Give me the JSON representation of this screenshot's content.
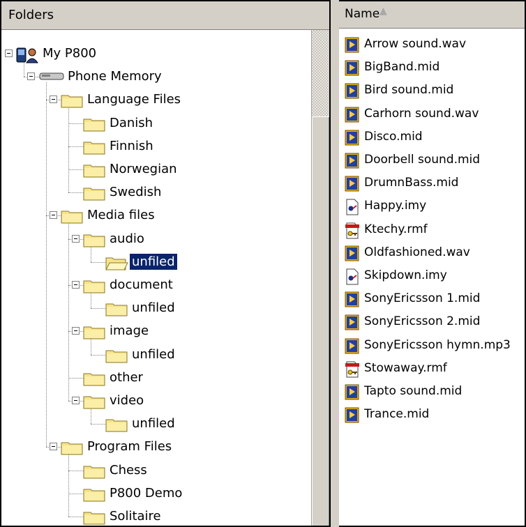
{
  "folders_pane": {
    "header": "Folders"
  },
  "files_pane": {
    "column_header": "Name",
    "sort_indicator": "▲"
  },
  "tree": [
    {
      "label": "My P800",
      "depth": 0,
      "kind": "device",
      "expanded": true
    },
    {
      "label": "Phone Memory",
      "depth": 1,
      "kind": "drive",
      "expanded": true
    },
    {
      "label": "Language Files",
      "depth": 2,
      "kind": "folder",
      "expanded": true
    },
    {
      "label": "Danish",
      "depth": 3,
      "kind": "folder"
    },
    {
      "label": "Finnish",
      "depth": 3,
      "kind": "folder"
    },
    {
      "label": "Norwegian",
      "depth": 3,
      "kind": "folder"
    },
    {
      "label": "Swedish",
      "depth": 3,
      "kind": "folder"
    },
    {
      "label": "Media files",
      "depth": 2,
      "kind": "folder",
      "expanded": true
    },
    {
      "label": "audio",
      "depth": 3,
      "kind": "folder",
      "expanded": true
    },
    {
      "label": "unfiled",
      "depth": 4,
      "kind": "folder-open",
      "selected": true
    },
    {
      "label": "document",
      "depth": 3,
      "kind": "folder",
      "expanded": true
    },
    {
      "label": "unfiled",
      "depth": 4,
      "kind": "folder"
    },
    {
      "label": "image",
      "depth": 3,
      "kind": "folder",
      "expanded": true
    },
    {
      "label": "unfiled",
      "depth": 4,
      "kind": "folder"
    },
    {
      "label": "other",
      "depth": 3,
      "kind": "folder"
    },
    {
      "label": "video",
      "depth": 3,
      "kind": "folder",
      "expanded": true
    },
    {
      "label": "unfiled",
      "depth": 4,
      "kind": "folder"
    },
    {
      "label": "Program Files",
      "depth": 2,
      "kind": "folder",
      "expanded": true
    },
    {
      "label": "Chess",
      "depth": 3,
      "kind": "folder"
    },
    {
      "label": "P800 Demo",
      "depth": 3,
      "kind": "folder"
    },
    {
      "label": "Solitaire",
      "depth": 3,
      "kind": "folder"
    }
  ],
  "files": [
    {
      "name": "Arrow sound.wav",
      "icon": "media-file-icon"
    },
    {
      "name": "BigBand.mid",
      "icon": "media-file-icon"
    },
    {
      "name": "Bird sound.mid",
      "icon": "media-file-icon"
    },
    {
      "name": "Carhorn sound.wav",
      "icon": "media-file-icon"
    },
    {
      "name": "Disco.mid",
      "icon": "media-file-icon"
    },
    {
      "name": "Doorbell sound.mid",
      "icon": "media-file-icon"
    },
    {
      "name": "DrumnBass.mid",
      "icon": "media-file-icon"
    },
    {
      "name": "Happy.imy",
      "icon": "imy-file-icon"
    },
    {
      "name": "Ktechy.rmf",
      "icon": "rmf-file-icon"
    },
    {
      "name": "Oldfashioned.wav",
      "icon": "media-file-icon"
    },
    {
      "name": "Skipdown.imy",
      "icon": "imy-file-icon"
    },
    {
      "name": "SonyEricsson 1.mid",
      "icon": "media-file-icon"
    },
    {
      "name": "SonyEricsson 2.mid",
      "icon": "media-file-icon"
    },
    {
      "name": "SonyEricsson hymn.mp3",
      "icon": "media-file-icon"
    },
    {
      "name": "Stowaway.rmf",
      "icon": "rmf-file-icon"
    },
    {
      "name": "Tapto sound.mid",
      "icon": "media-file-icon"
    },
    {
      "name": "Trance.mid",
      "icon": "media-file-icon"
    }
  ],
  "colors": {
    "selection": "#0a246a",
    "folder": "#f7e38a",
    "chrome": "#d4d0c8"
  }
}
